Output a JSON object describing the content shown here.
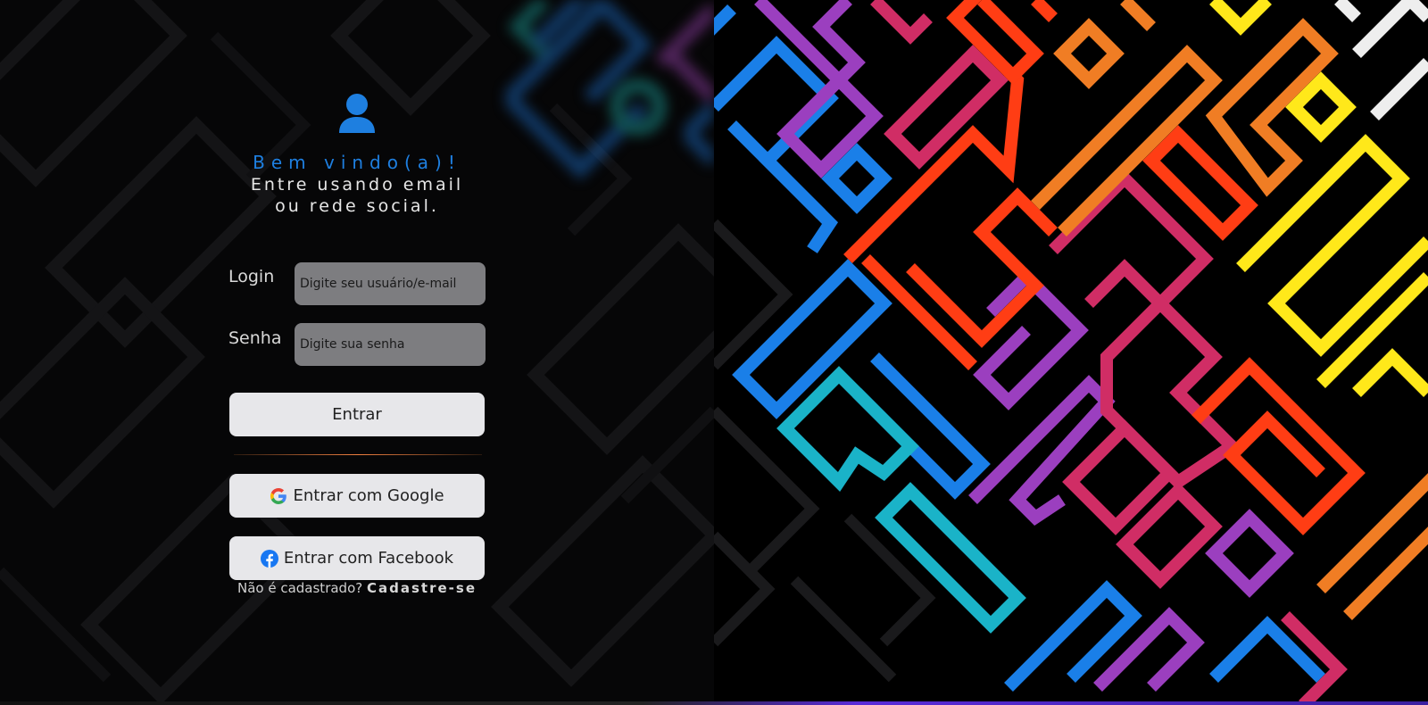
{
  "login": {
    "welcome_title": "Bem vindo(a)!",
    "subtitle": "Entre usando email ou rede social.",
    "fields": {
      "login_label": "Login",
      "login_placeholder": "Digite seu usuário/e-mail",
      "password_label": "Senha",
      "password_placeholder": "Digite sua senha"
    },
    "submit_label": "Entrar",
    "google_label": "Entrar com Google",
    "facebook_label": "Entrar com Facebook",
    "signup_prompt": "Não é cadastrado?",
    "signup_link": "Cadastre-se"
  },
  "colors": {
    "accent_blue": "#1e7fe0",
    "facebook_blue": "#1877f2",
    "button_bg": "#e7e7ea",
    "input_bg": "#7d7d80"
  },
  "icons": {
    "avatar": "user-icon",
    "google": "google-icon",
    "facebook": "facebook-icon"
  }
}
